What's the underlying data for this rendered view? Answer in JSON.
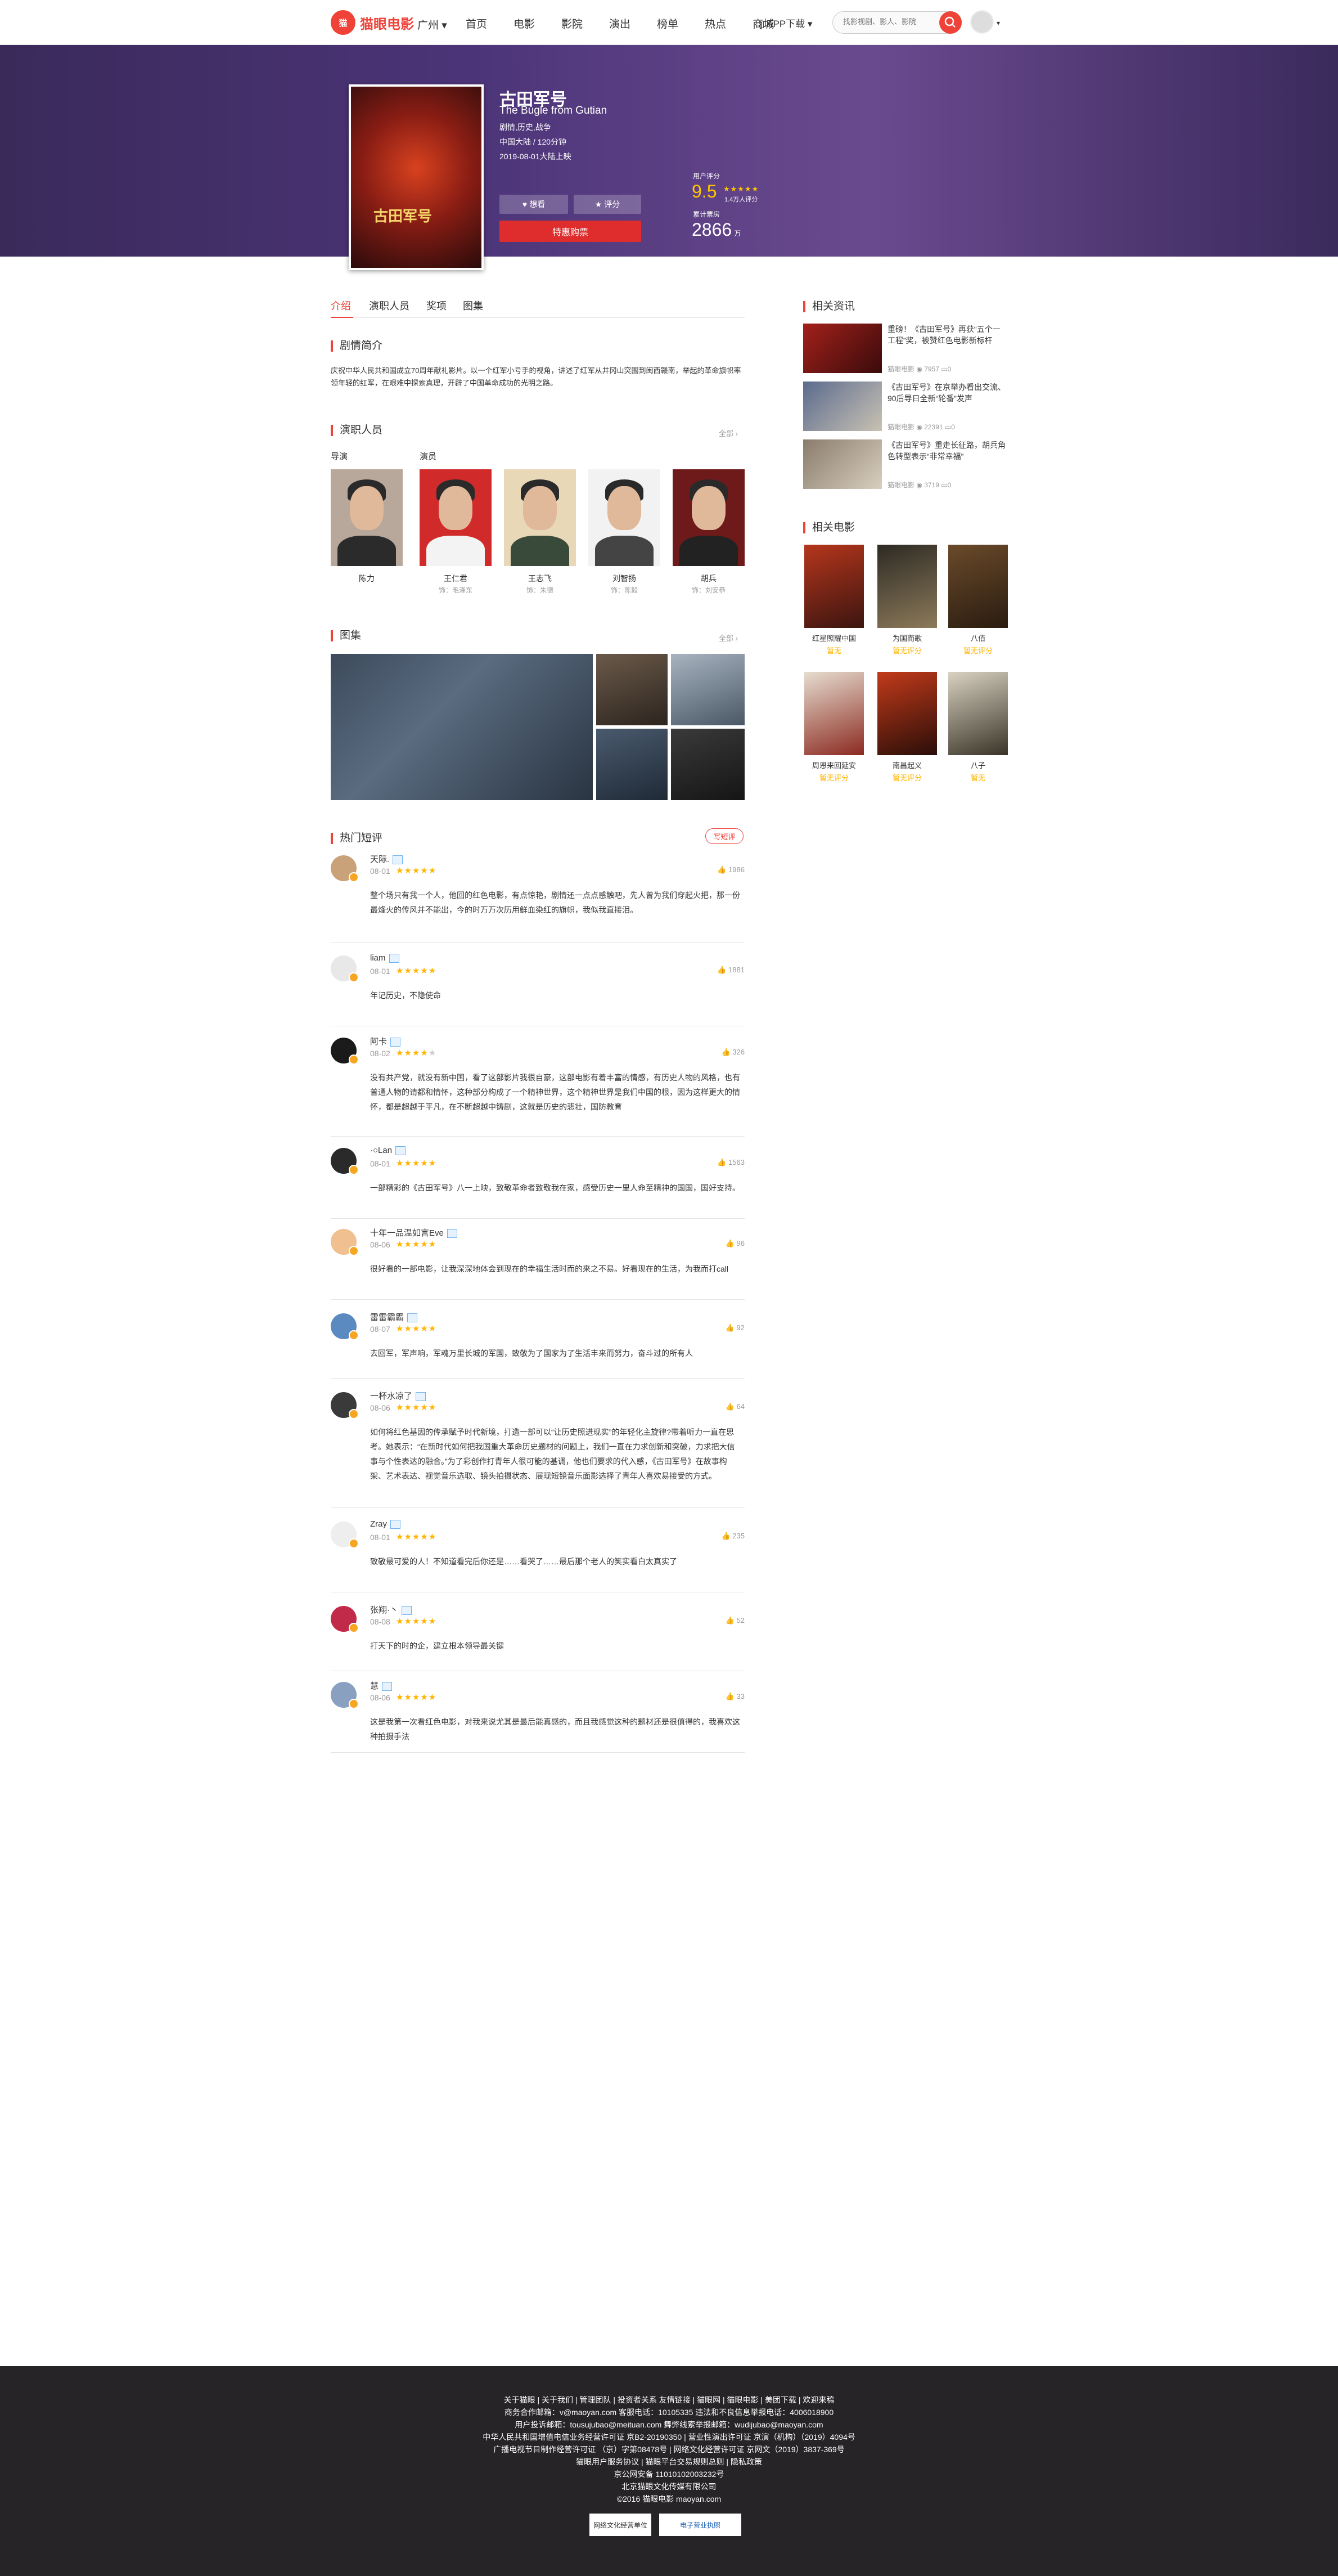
{
  "nav": {
    "logo_text": "猫眼电影",
    "logo_mark": "maoyan",
    "city": "广州",
    "links": [
      "首页",
      "电影",
      "影院",
      "演出",
      "榜单",
      "热点",
      "商城"
    ],
    "app_download": "APP下载",
    "search_placeholder": "找影视剧、影人、影院"
  },
  "movie": {
    "title": "古田军号",
    "ename": "The Bugle from Gutian",
    "genre": "剧情,历史,战争",
    "region_duration": "中国大陆 / 120分钟",
    "release": "2019-08-01大陆上映",
    "poster_text": "古田军号",
    "like_label": "想看",
    "rate_label": "评分",
    "buy_label": "特惠购票",
    "score_label": "用户评分",
    "score": "9.5",
    "score_count": "1.4万人评分",
    "box_label": "累计票房",
    "box_value": "2866",
    "box_unit": "万"
  },
  "tabs": [
    "介绍",
    "演职人员",
    "奖项",
    "图集"
  ],
  "synopsis": {
    "title": "剧情简介",
    "text": "庆祝中华人民共和国成立70周年献礼影片。以一个红军小号手的视角，讲述了红军从井冈山突围到闽西赣南，举起的革命旗帜率领年轻的红军，在艰难中探索真理，开辟了中国革命成功的光明之路。"
  },
  "cast_section": {
    "title": "演职人员",
    "more": "全部",
    "director_label": "导演",
    "actor_label": "演员",
    "people": [
      {
        "name": "陈力",
        "role": ""
      },
      {
        "name": "王仁君",
        "role": "饰：毛泽东"
      },
      {
        "name": "王志飞",
        "role": "饰：朱德"
      },
      {
        "name": "刘智扬",
        "role": "饰：陈毅"
      },
      {
        "name": "胡兵",
        "role": "饰：刘安恭"
      }
    ]
  },
  "gallery": {
    "title": "图集",
    "more": "全部"
  },
  "comments_section": {
    "title": "热门短评",
    "write_label": "写短评",
    "items": [
      {
        "name": "天际.",
        "date": "08-01",
        "stars": 5,
        "likes": "1986",
        "text": "整个场只有我一个人，他回的红色电影，有点惊艳，剧情还一点点感触吧，先人曾为我们穿起火把，那一份最烽火的传风并不能出，今的时万万次历用鲜血染红的旗帜，我似我直接泪。"
      },
      {
        "name": "liam",
        "date": "08-01",
        "stars": 5,
        "likes": "1881",
        "text": "年记历史，不隐使命"
      },
      {
        "name": "阿卡",
        "date": "08-02",
        "stars": 4,
        "likes": "326",
        "text": "没有共产党，就没有新中国，看了这部影片我很自豪，这部电影有着丰富的情感，有历史人物的风格，也有普通人物的请都和情怀，这种部分构成了一个精神世界，这个精神世界是我们中国的根，因为这样更大的情怀，都是超越于平凡，在不断超越中铸剧，这就是历史的悲壮，国防教育"
      },
      {
        "name": "·○Lan",
        "date": "08-01",
        "stars": 5,
        "likes": "1563",
        "text": "一部精彩的《古田军号》八一上映，致敬革命者致敬我在家，感受历史一里人命至精神的国国，国好支持。"
      },
      {
        "name": "十年一品温如言Eve",
        "date": "08-06",
        "stars": 5,
        "likes": "96",
        "text": "很好看的一部电影，让我深深地体会到现在的幸福生活时而的来之不易。好看现在的生活，为我而打call"
      },
      {
        "name": "雷雷霸霸",
        "date": "08-07",
        "stars": 4.5,
        "likes": "92",
        "text": "去回军，军声响，军魂万里长城的军国，致敬为了国家为了生活丰来而努力，奋斗过的所有人"
      },
      {
        "name": "一杯水凉了",
        "date": "08-06",
        "stars": 5,
        "likes": "64",
        "text": "如何将红色基因的传承赋予时代新境，打造一部可以“让历史照进现实”的年轻化主旋律?带着听力一直在思考。她表示：“在新时代如何把我国重大革命历史题材的问题上，我们一直在力求创新和突破，力求把大信事与个性表达的融合。”为了彩创作打青年人很可能的基调，他也们要求的代入感，《古田军号》在故事构架、艺术表达、视觉音乐选取、镜头拍摄状态、展现短镜音乐面影选择了青年人喜欢易接受的方式。"
      },
      {
        "name": "Zray",
        "date": "08-01",
        "stars": 5,
        "likes": "235",
        "text": "致敬最可爱的人！不知道看完后你还是……看哭了……最后那个老人的笑实看白太真实了"
      },
      {
        "name": "张翔·丶",
        "date": "08-08",
        "stars": 5,
        "likes": "52",
        "text": "打天下的时的企，建立根本领导最关键"
      },
      {
        "name": "慧",
        "date": "08-06",
        "stars": 5,
        "likes": "33",
        "text": "这是我第一次看红色电影，对我来说尤其是最后能真感的，而且我感觉这种的题材还是很值得的，我喜欢这种拍摄手法"
      }
    ]
  },
  "side": {
    "news_title": "相关资讯",
    "news": [
      {
        "title": "重磅！《古田军号》再获“五个一工程”奖，被赞红色电影新标杆",
        "source": "猫眼电影",
        "views": "7957",
        "comments": "0"
      },
      {
        "title": "《古田军号》在京举办看出交流、90后导日全新“轮番”发声",
        "source": "猫眼电影",
        "views": "22391",
        "comments": "0"
      },
      {
        "title": "《古田军号》重走长征路，胡兵角色转型表示“非常幸福”",
        "source": "猫眼电影",
        "views": "3719",
        "comments": "0"
      }
    ],
    "related_title": "相关电影",
    "related": [
      {
        "name": "红星照耀中国",
        "score": "暂无"
      },
      {
        "name": "为国而歌",
        "score": "暂无评分"
      },
      {
        "name": "八佰",
        "score": "暂无评分"
      },
      {
        "name": "周恩来回延安",
        "score": "暂无评分"
      },
      {
        "name": "南昌起义",
        "score": "暂无评分"
      },
      {
        "name": "八子",
        "score": "暂无"
      }
    ]
  },
  "footer": {
    "line1": "关于猫眼 | 关于我们 | 管理团队 | 投资者关系   友情链接 | 猫眼网 | 猫眼电影 | 美团下载 | 欢迎来稿",
    "line2": "商务合作邮箱：v@maoyan.com  客服电话：10105335  违法和不良信息举报电话：4006018900",
    "line3": "用户投诉邮箱：tousujubao@meituan.com  舞弊线索举报邮箱：wudijubao@maoyan.com",
    "line4": "中华人民共和国增值电信业务经营许可证 京B2-20190350 | 营业性演出许可证 京演（机构）（2019）4094号",
    "line5": "广播电视节目制作经营许可证 （京）字第08478号 | 网络文化经营许可证 京网文（2019）3837-369号",
    "line6": "猫眼用户服务协议 | 猫眼平台交易规则总则 | 隐私政策",
    "line7": "京公网安备 11010102003232号",
    "line8": "北京猫眼文化传媒有限公司",
    "line9": "©2016 猫眼电影 maoyan.com",
    "badge1": "网络文化经营单位",
    "badge2": "电子营业执照"
  },
  "colors": {
    "brand": "#ef4238",
    "banner": "#4c3478",
    "star": "#ffb400",
    "footer": "#262426"
  }
}
